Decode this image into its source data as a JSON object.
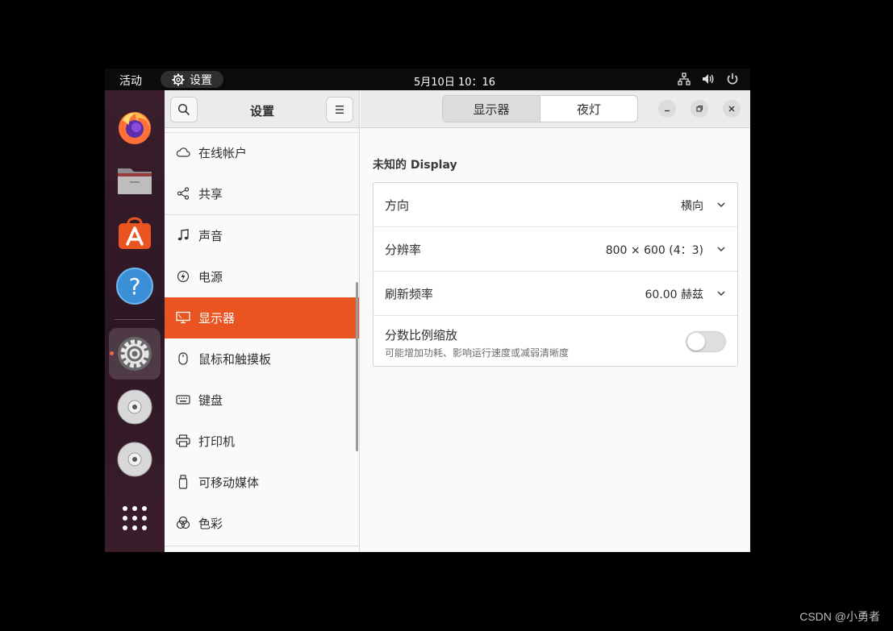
{
  "topbar": {
    "activities": "活动",
    "app_name": "设置",
    "clock": "5月10日  10：16"
  },
  "dock": {
    "items": [
      "firefox",
      "files",
      "app-center",
      "help",
      "settings",
      "optical-disc",
      "optical-disc",
      "show-applications"
    ]
  },
  "sidebar": {
    "title": "设置",
    "items": [
      {
        "label": "在线帐户",
        "icon": "cloud-icon"
      },
      {
        "label": "共享",
        "icon": "share-icon"
      },
      {
        "label": "声音",
        "icon": "music-note-icon"
      },
      {
        "label": "电源",
        "icon": "power-icon"
      },
      {
        "label": "显示器",
        "icon": "display-icon"
      },
      {
        "label": "鼠标和触摸板",
        "icon": "mouse-icon"
      },
      {
        "label": "键盘",
        "icon": "keyboard-icon"
      },
      {
        "label": "打印机",
        "icon": "printer-icon"
      },
      {
        "label": "可移动媒体",
        "icon": "usb-drive-icon"
      },
      {
        "label": "色彩",
        "icon": "color-icon"
      }
    ],
    "selected": "显示器"
  },
  "content": {
    "tabs": [
      {
        "label": "显示器"
      },
      {
        "label": "夜灯"
      }
    ],
    "active_tab": "显示器",
    "display_name": "未知的 Display",
    "rows": [
      {
        "label": "方向",
        "value": "横向"
      },
      {
        "label": "分辨率",
        "value": "800 × 600 (4：3)"
      },
      {
        "label": "刷新频率",
        "value": "60.00 赫兹"
      },
      {
        "label": "分数比例缩放",
        "subtitle": "可能增加功耗、影响运行速度或减弱清晰度",
        "toggle": false
      }
    ]
  },
  "watermark": "CSDN @小勇者",
  "colors": {
    "accent": "#e95420",
    "topbar": "#0b0b0b",
    "dock": "#2e1725"
  }
}
